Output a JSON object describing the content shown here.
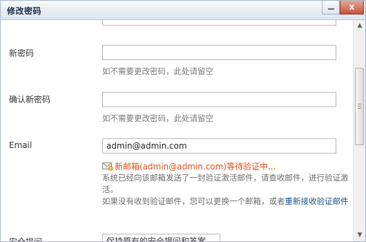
{
  "window": {
    "title": "修改密码",
    "close_label": "x"
  },
  "form": {
    "new_password": {
      "label": "新密码",
      "value": "",
      "hint": "如不需要更改密码，此处请留空"
    },
    "confirm_password": {
      "label": "确认新密码",
      "value": "",
      "hint": "如不需要更改密码，此处请留空"
    },
    "email": {
      "label": "Email",
      "value": "admin@admin.com",
      "pending_text": "新邮箱(admin@admin.com)等待验证中...",
      "info_line1": "系统已经向该邮箱发送了一封验证激活邮件，请查收邮件，进行验证激活。",
      "info_line2_prefix": "如果没有收到验证邮件，您可以更换一个邮箱，或者",
      "resend_link": "重新接收验证邮件"
    },
    "security": {
      "label": "安全提问",
      "select_value": "保持原有的安全提问和答案"
    }
  },
  "icons": {
    "mail": "mail-pending-icon",
    "minimize": "minimize-icon",
    "close": "close-icon"
  },
  "colors": {
    "pending": "#e04e1b",
    "link": "#1a4f8b",
    "hint": "#7a7a7a"
  }
}
